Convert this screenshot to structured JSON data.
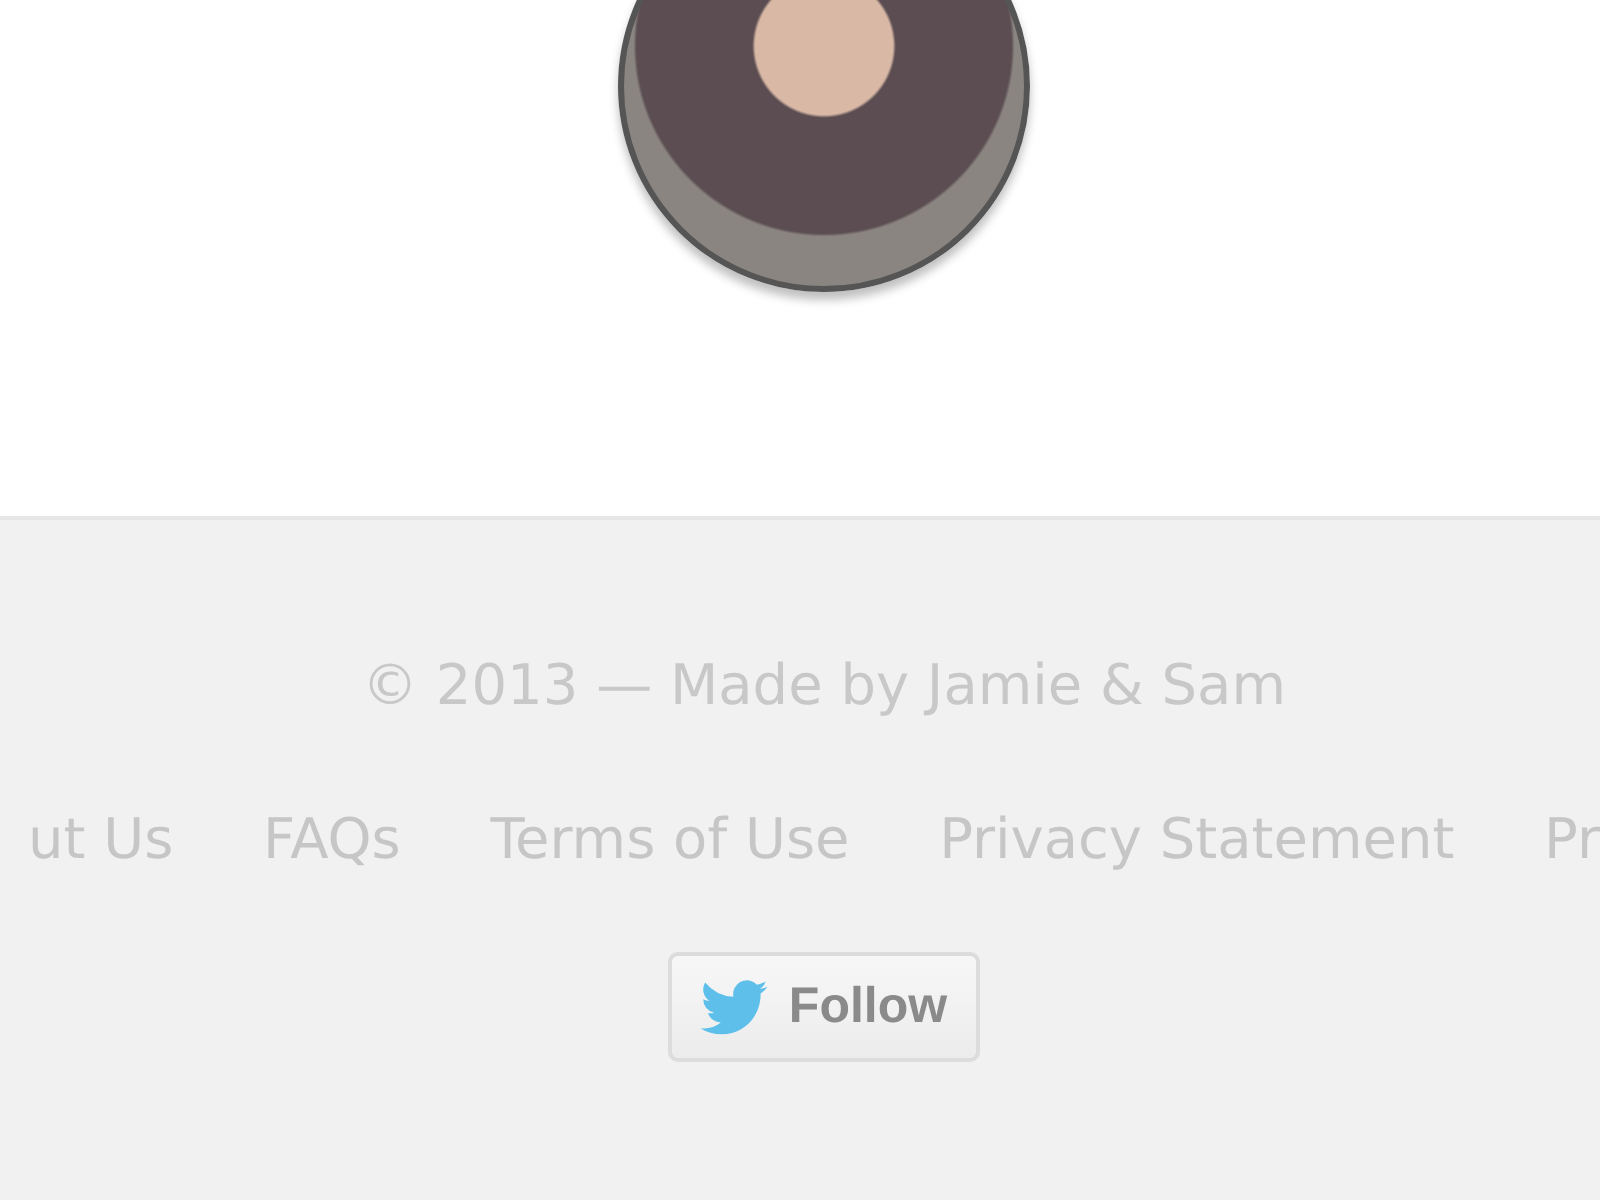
{
  "footer": {
    "copyright": "© 2013 — Made by Jamie & Sam",
    "links": [
      "ut Us",
      "FAQs",
      "Terms of Use",
      "Privacy Statement",
      "Pr"
    ],
    "follow_button": {
      "label": "Follow"
    }
  }
}
